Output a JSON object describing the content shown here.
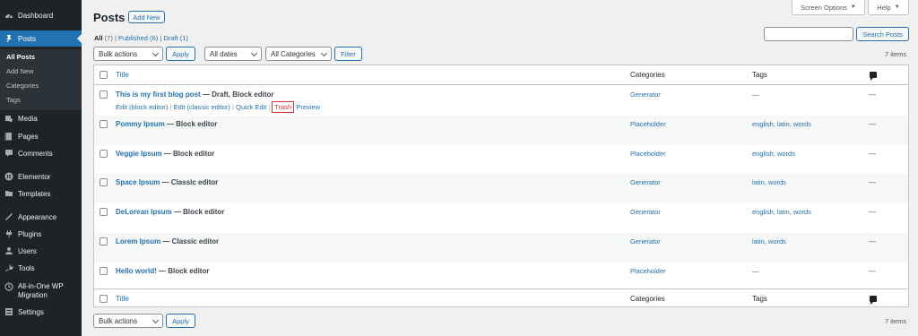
{
  "sidebar": {
    "dashboard": "Dashboard",
    "posts": "Posts",
    "sub": [
      "All Posts",
      "Add New",
      "Categories",
      "Tags"
    ],
    "media": "Media",
    "pages": "Pages",
    "comments": "Comments",
    "elementor": "Elementor",
    "templates": "Templates",
    "appearance": "Appearance",
    "plugins": "Plugins",
    "users": "Users",
    "tools": "Tools",
    "migration_line1": "All-in-One WP",
    "migration_line2": "Migration",
    "settings": "Settings"
  },
  "header": {
    "title": "Posts",
    "add_new": "Add New",
    "screen_options": "Screen Options",
    "help": "Help",
    "search_button": "Search Posts",
    "search_value": ""
  },
  "views": {
    "all": "All",
    "all_count": "(7)",
    "published": "Published",
    "published_count": "(6)",
    "draft": "Draft",
    "draft_count": "(1)",
    "sep": "|"
  },
  "filters": {
    "bulk_actions": "Bulk actions",
    "apply": "Apply",
    "dates": "All dates",
    "categories": "All Categories",
    "filter": "Filter",
    "items_count": "7 items"
  },
  "table": {
    "col_title": "Title",
    "col_categories": "Categories",
    "col_tags": "Tags",
    "rows": [
      {
        "title": "This is my first blog post",
        "state": " — Draft, Block editor",
        "category": "Generator",
        "tags": "—",
        "comments": "—"
      },
      {
        "title": "Pommy Ipsum",
        "state": " — Block editor",
        "category": "Placeholder",
        "tags": "english, latin, words",
        "comments": "—"
      },
      {
        "title": "Veggie Ipsum",
        "state": " — Block editor",
        "category": "Placeholder",
        "tags": "english, words",
        "comments": "—"
      },
      {
        "title": "Space Ipsum",
        "state": " — Classic editor",
        "category": "Generator",
        "tags": "latin, words",
        "comments": "—"
      },
      {
        "title": "DeLorean Ipsum",
        "state": " — Block editor",
        "category": "Generator",
        "tags": "english, latin, words",
        "comments": "—"
      },
      {
        "title": "Lorem Ipsum",
        "state": " — Classic editor",
        "category": "Generator",
        "tags": "latin, words",
        "comments": "—"
      },
      {
        "title": "Hello world!",
        "state": " — Block editor",
        "category": "Placeholder",
        "tags": "—",
        "comments": "—"
      }
    ],
    "row_actions": {
      "edit_block": "Edit (block editor)",
      "edit_classic": "Edit (classic editor)",
      "quick_edit": "Quick Edit",
      "trash": "Trash",
      "preview": "Preview",
      "sep": "|"
    }
  },
  "colors": {
    "accent": "#2271b1",
    "sidebar_bg": "#1d2327",
    "highlight_border": "#d63638"
  }
}
